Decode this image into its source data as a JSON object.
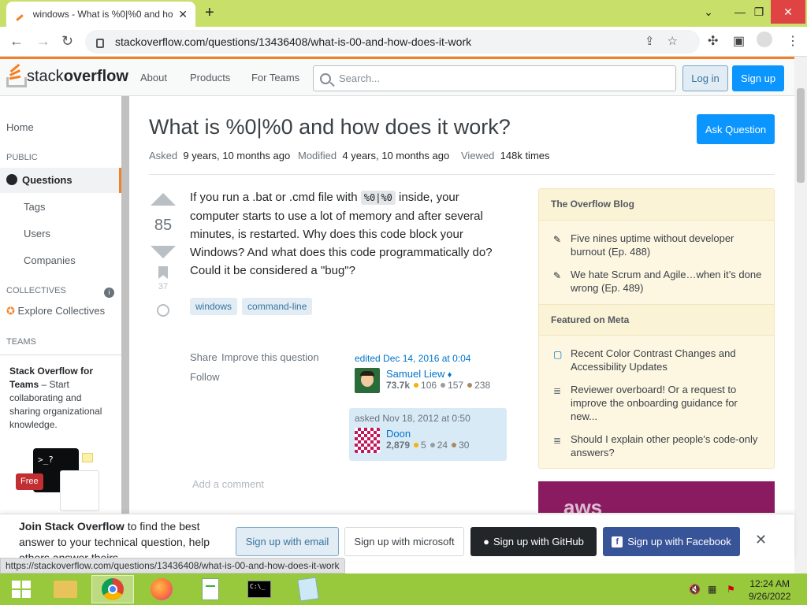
{
  "browser": {
    "tab_title": "windows - What is %0|%0 and ho",
    "tab_close": "✕",
    "new_tab": "+",
    "url": "stackoverflow.com/questions/13436408/what-is-00-and-how-does-it-work",
    "status_url": "https://stackoverflow.com/questions/13436408/what-is-00-and-how-does-it-work"
  },
  "header": {
    "logo_light": "stack",
    "logo_bold": "overflow",
    "nav": [
      "About",
      "Products",
      "For Teams"
    ],
    "search_placeholder": "Search...",
    "login": "Log in",
    "signup": "Sign up"
  },
  "sidebar": {
    "home": "Home",
    "public": "PUBLIC",
    "questions": "Questions",
    "tags": "Tags",
    "users": "Users",
    "companies": "Companies",
    "collectives": "COLLECTIVES",
    "explore_collectives": "Explore Collectives",
    "teams_heading": "TEAMS",
    "teams_title": "Stack Overflow for Teams",
    "teams_text": " – Start collaborating and sharing organizational knowledge.",
    "free_badge": "Free"
  },
  "question": {
    "title": "What is %0|%0 and how does it work?",
    "ask_button": "Ask Question",
    "asked_label": "Asked",
    "asked_value": "9 years, 10 months ago",
    "modified_label": "Modified",
    "modified_value": "4 years, 10 months ago",
    "viewed_label": "Viewed",
    "viewed_value": "148k times",
    "score": "85",
    "bookmarks": "37",
    "body_pre": "If you run a .bat or .cmd file with ",
    "body_code": "%0|%0",
    "body_post": " inside, your computer starts to use a lot of memory and after several minutes, is restarted. Why does this code block your Windows? And what does this code programmatically do? Could it be considered a \"bug\"?",
    "tags": [
      "windows",
      "command-line"
    ],
    "share": "Share",
    "improve": "Improve this question",
    "follow": "Follow",
    "edited": "edited Dec 14, 2016 at 0:04",
    "editor_name": "Samuel Liew",
    "editor_mod": "♦",
    "editor_rep": "73.7k",
    "editor_gold": "106",
    "editor_silver": "157",
    "editor_bronze": "238",
    "asked_on": "asked Nov 18, 2012 at 0:50",
    "asker_name": "Doon",
    "asker_rep": "2,879",
    "asker_gold": "5",
    "asker_silver": "24",
    "asker_bronze": "30",
    "add_comment": "Add a comment"
  },
  "right": {
    "blog_heading": "The Overflow Blog",
    "blog_items": [
      "Five nines uptime without developer burnout (Ep. 488)",
      "We hate Scrum and Agile…when it’s done wrong (Ep. 489)"
    ],
    "meta_heading": "Featured on Meta",
    "meta_items": [
      "Recent Color Contrast Changes and Accessibility Updates",
      "Reviewer overboard! Or a request to improve the onboarding guidance for new...",
      "Should I explain other people's code-only answers?"
    ],
    "ad_text": "aws"
  },
  "joinbar": {
    "bold": "Join Stack Overflow",
    "text": " to find the best answer to your technical question, help others answer theirs.",
    "email": "Sign up with email",
    "microsoft": "Sign up with microsoft",
    "github": "Sign up with GitHub",
    "facebook": "Sign up with Facebook",
    "close": "✕"
  },
  "taskbar": {
    "time": "12:24 AM",
    "date": "9/26/2022"
  },
  "colors": {
    "accent": "#f48024",
    "primary": "#0a95ff",
    "taskbar": "#98c83c",
    "chrome_tabbar": "#c8e06a"
  }
}
